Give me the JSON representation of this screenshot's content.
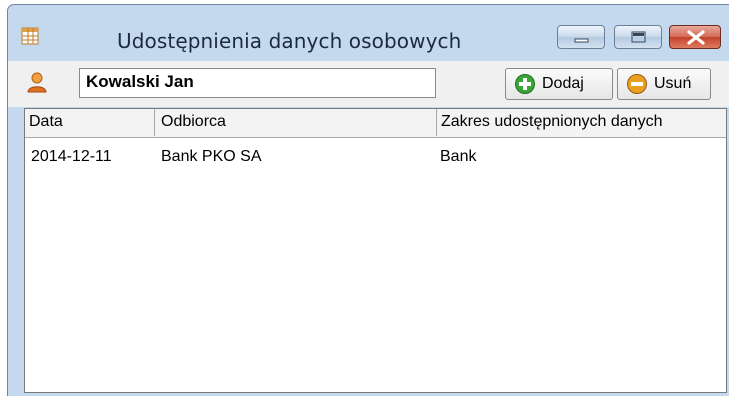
{
  "window": {
    "title": "Udostępnienia danych osobowych",
    "icons": {
      "app": "table-grid-icon",
      "minimize": "minimize-icon",
      "maximize": "maximize-icon",
      "close": "close-icon"
    }
  },
  "toolbar": {
    "user_icon": "person-icon",
    "person_name": "Kowalski Jan",
    "add_label": "Dodaj",
    "remove_label": "Usuń",
    "add_icon": "plus-circle-icon",
    "remove_icon": "minus-circle-icon"
  },
  "grid": {
    "columns": [
      "Data",
      "Odbiorca",
      "Zakres udostępnionych danych"
    ],
    "rows": [
      {
        "date": "2014-12-11",
        "recipient": "Bank PKO SA",
        "scope": "Bank"
      }
    ]
  },
  "colors": {
    "frame": "#c5d9ee",
    "close_button": "#c3432b",
    "add_green": "#3aa63a",
    "remove_orange": "#e8a020"
  }
}
